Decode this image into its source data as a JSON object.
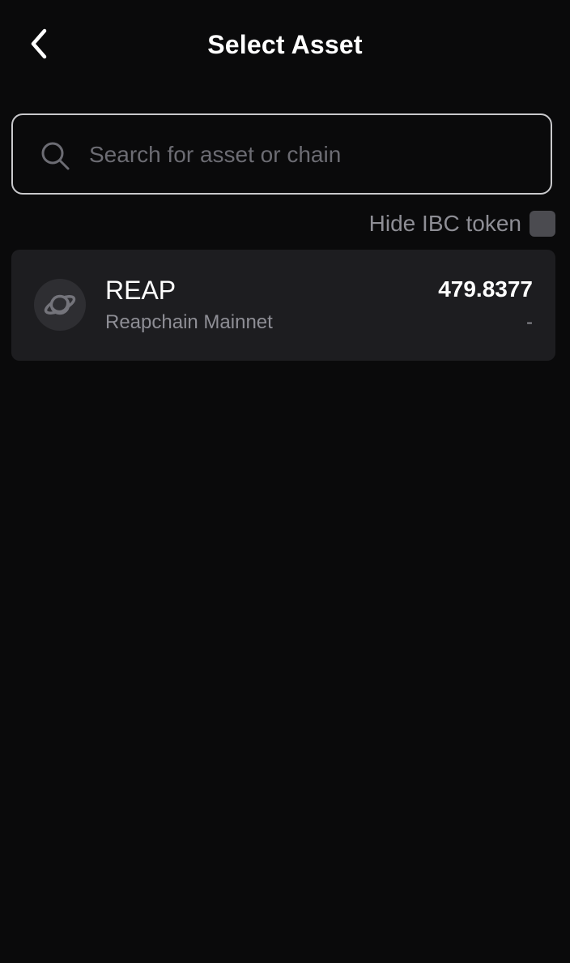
{
  "header": {
    "title": "Select Asset",
    "back_icon": "chevron-left-icon"
  },
  "search": {
    "placeholder": "Search for asset or chain",
    "value": "",
    "icon": "search-icon"
  },
  "filter": {
    "hide_ibc_label": "Hide IBC token",
    "hide_ibc_checked": false
  },
  "assets": [
    {
      "symbol": "REAP",
      "chain": "Reapchain Mainnet",
      "balance": "479.8377",
      "fiat_value": "-",
      "icon": "planet-icon"
    }
  ],
  "colors": {
    "background": "#0a0a0b",
    "card": "#1d1d20",
    "text_primary": "#ffffff",
    "text_secondary": "#8e8e95",
    "search_border": "#c9c9cc",
    "checkbox": "#4b4b50"
  }
}
